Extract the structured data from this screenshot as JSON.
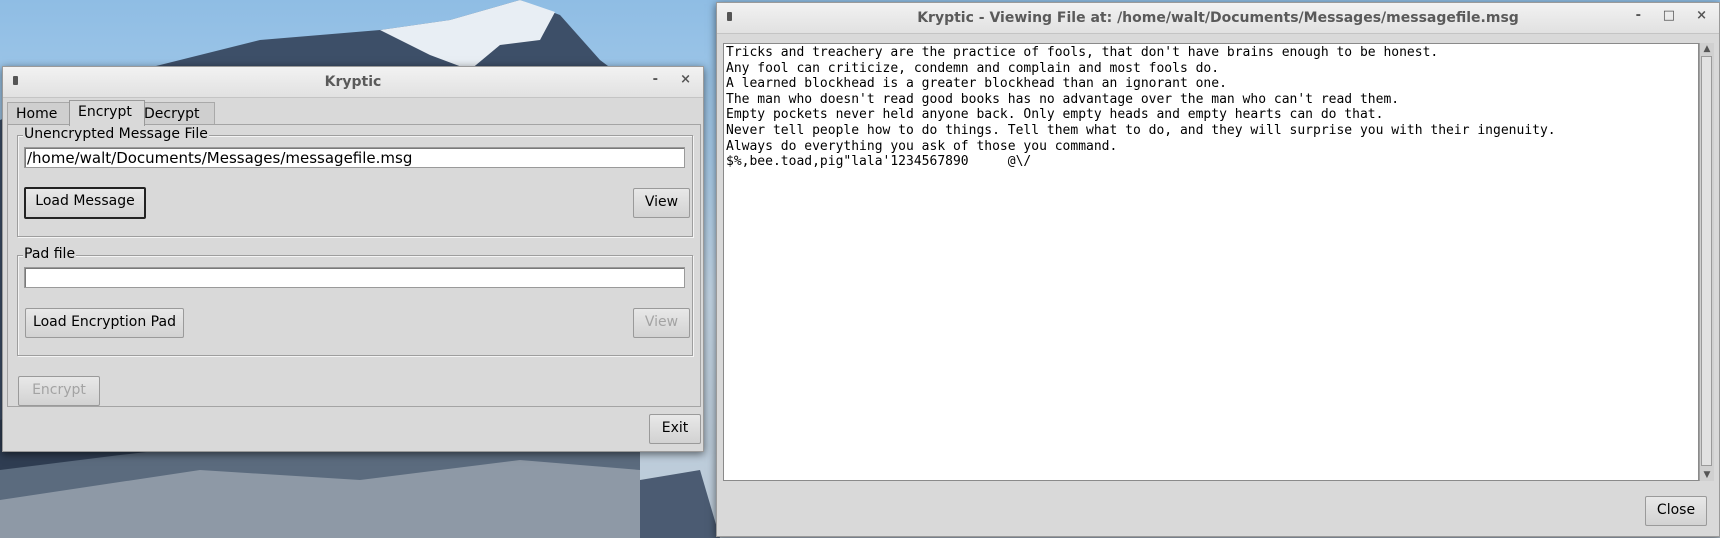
{
  "main_window": {
    "title": "Kryptic",
    "minimize": "-",
    "close": "×",
    "tabs": [
      {
        "label": "Home"
      },
      {
        "label": "Encrypt"
      },
      {
        "label": "Decrypt"
      }
    ],
    "active_tab": "Encrypt",
    "message_group": {
      "label": "Unencrypted Message File",
      "path_value": "/home/walt/Documents/Messages/messagefile.msg",
      "load_button": "Load Message",
      "view_button": "View"
    },
    "pad_group": {
      "label": "Pad file",
      "path_value": "",
      "load_button": "Load Encryption Pad",
      "view_button": "View"
    },
    "encrypt_button": "Encrypt",
    "exit_button": "Exit"
  },
  "viewer_window": {
    "title": "Kryptic - Viewing File at: /home/walt/Documents/Messages/messagefile.msg",
    "minimize": "-",
    "maximize": "□",
    "close": "×",
    "lines": [
      "Tricks and treachery are the practice of fools, that don't have brains enough to be honest.",
      "Any fool can criticize, condemn and complain and most fools do.",
      "A learned blockhead is a greater blockhead than an ignorant one.",
      "The man who doesn't read good books has no advantage over the man who can't read them.",
      "Empty pockets never held anyone back. Only empty heads and empty hearts can do that.",
      "Never tell people how to do things. Tell them what to do, and they will surprise you with their ingenuity.",
      "Always do everything you ask of those you command.",
      "$%,bee.toad,pig\"lala'1234567890     @\\/"
    ],
    "close_button": "Close"
  }
}
